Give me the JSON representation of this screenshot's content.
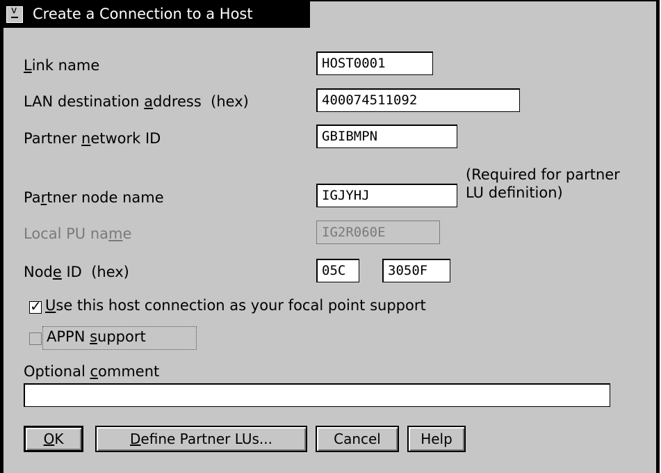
{
  "window": {
    "title": "Create a Connection to a Host"
  },
  "fields": {
    "link_name": {
      "label": "Link name",
      "value": "HOST0001"
    },
    "lan_address": {
      "label": "LAN destination address  (hex)",
      "value": "400074511092"
    },
    "partner_network": {
      "label": "Partner network ID",
      "value": "GBIBMPN"
    },
    "partner_node": {
      "label": "Partner node name",
      "value": "IGJYHJ",
      "note": "(Required for partner LU definition)"
    },
    "local_pu": {
      "label": "Local PU name",
      "value": "IG2R060E"
    },
    "node_id": {
      "label": "Node ID  (hex)",
      "value1": "05C",
      "value2": "3050F"
    },
    "comment": {
      "label": "Optional comment",
      "value": ""
    }
  },
  "checkboxes": {
    "focal_point": {
      "label": "Use this host connection as your focal point support",
      "checked": true
    },
    "appn": {
      "label": "APPN support",
      "checked": false
    }
  },
  "buttons": {
    "ok": "OK",
    "define_partner": "Define Partner LUs...",
    "cancel": "Cancel",
    "help": "Help"
  }
}
